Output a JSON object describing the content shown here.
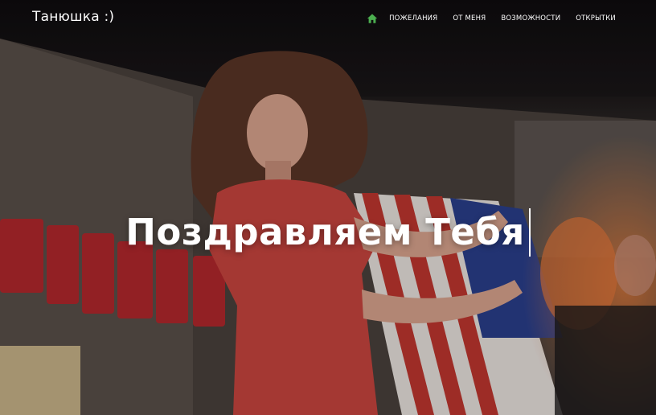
{
  "brand": {
    "title": "Танюшка :)"
  },
  "nav": {
    "home_icon": "home-icon",
    "items": [
      {
        "label": "ПОЖЕЛАНИЯ"
      },
      {
        "label": "ОТ МЕНЯ"
      },
      {
        "label": "ВОЗМОЖНОСТИ"
      },
      {
        "label": "ОТКРЫТКИ"
      }
    ]
  },
  "hero": {
    "headline": "Поздравляем Тебя"
  },
  "colors": {
    "accent": "#4caf50",
    "text": "#ffffff"
  }
}
